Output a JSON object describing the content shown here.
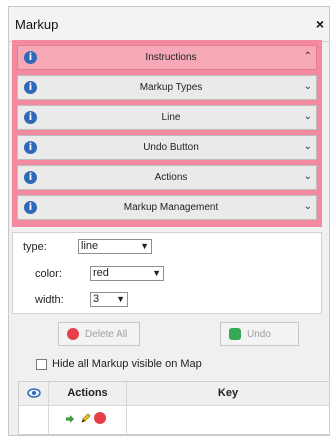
{
  "window": {
    "title": "Markup",
    "close_label": "×"
  },
  "accordion": [
    {
      "label": "Instructions",
      "icon": "info-icon",
      "active": true,
      "chevron": "up"
    },
    {
      "label": "Markup Types",
      "icon": "info-icon",
      "active": false,
      "chevron": "down"
    },
    {
      "label": "Line",
      "icon": "info-icon",
      "active": false,
      "chevron": "down"
    },
    {
      "label": "Undo Button",
      "icon": "info-icon",
      "active": false,
      "chevron": "down"
    },
    {
      "label": "Actions",
      "icon": "info-icon",
      "active": false,
      "chevron": "down"
    },
    {
      "label": "Markup Management",
      "icon": "info-icon",
      "active": false,
      "chevron": "down"
    }
  ],
  "settings": {
    "type_label": "type:",
    "type_value": "line",
    "color_label": "color:",
    "color_value": "red",
    "width_label": "width:",
    "width_value": "3"
  },
  "buttons": {
    "delete_all": "Delete All",
    "undo": "Undo"
  },
  "checkbox": {
    "label": "Hide all Markup visible on Map",
    "checked": false
  },
  "table": {
    "headers": [
      "",
      "Actions",
      "Key"
    ]
  },
  "colors": {
    "accent": "#f48aa0",
    "active_row": "#f6a8b6",
    "info_blue": "#2f68b7",
    "delete_red": "#e53f4a",
    "undo_green": "#34a853"
  }
}
